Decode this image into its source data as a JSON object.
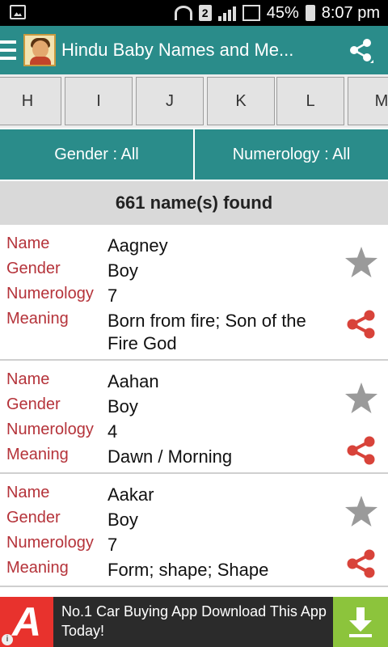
{
  "status_bar": {
    "sim_label": "2",
    "battery": "45%",
    "time": "8:07 pm"
  },
  "app_bar": {
    "title": "Hindu Baby Names and Me..."
  },
  "letters": [
    "H",
    "I",
    "J",
    "K",
    "L",
    "M"
  ],
  "filters": {
    "gender": "Gender : All",
    "numerology": "Numerology : All"
  },
  "results": "661 name(s) found",
  "field_labels": {
    "name": "Name",
    "gender": "Gender",
    "numerology": "Numerology",
    "meaning": "Meaning"
  },
  "names": [
    {
      "name": "Aagney",
      "gender": "Boy",
      "numerology": "7",
      "meaning": "Born from fire; Son of the Fire God"
    },
    {
      "name": "Aahan",
      "gender": "Boy",
      "numerology": "4",
      "meaning": "Dawn / Morning"
    },
    {
      "name": "Aakar",
      "gender": "Boy",
      "numerology": "7",
      "meaning": "Form; shape; Shape"
    }
  ],
  "ad": {
    "icon_letter": "A",
    "text": "No.1 Car Buying App Download This App Today!",
    "info": "i"
  },
  "colors": {
    "primary": "#2a8c8a",
    "label_red": "#b5333a",
    "share_red": "#d8433a",
    "star_gray": "#9a9a9a",
    "ad_green": "#8cc43c"
  },
  "icons": {
    "menu": "hamburger-icon",
    "share": "share-icon",
    "favorite": "star-icon",
    "download": "download-arrow-icon"
  }
}
